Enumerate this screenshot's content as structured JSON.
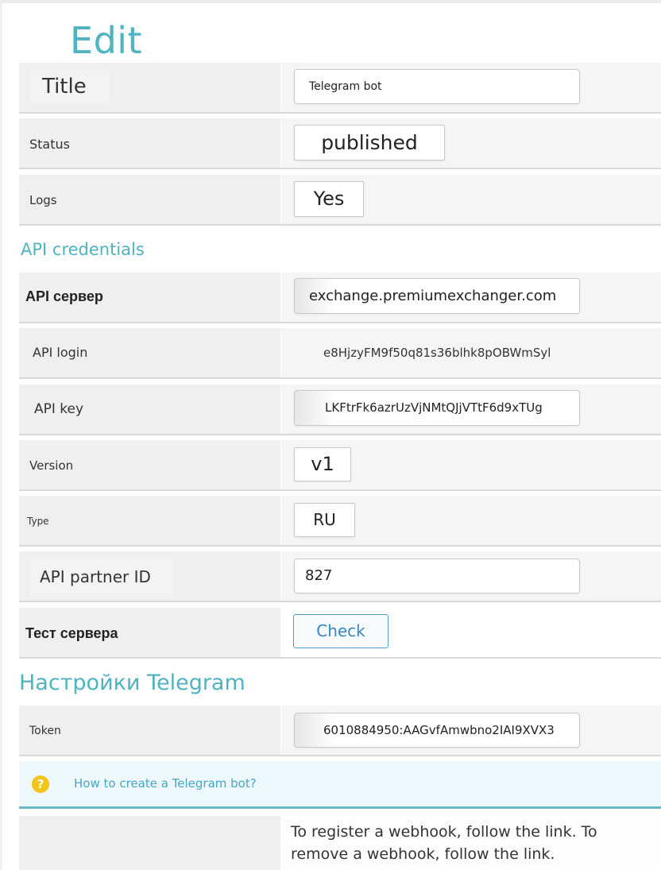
{
  "page": {
    "title": "Edit"
  },
  "general": {
    "title_label": "Title",
    "title_value": "Telegram bot",
    "status_label": "Status",
    "status_value": "published",
    "logs_label": "Logs",
    "logs_value": "Yes"
  },
  "api": {
    "section_title": "API credentials",
    "server_label": "API сервер",
    "server_value": "exchange.premiumexchanger.com",
    "login_label": "API login",
    "login_value": "e8HjzyFM9f50q81s36blhk8pOBWmSyl",
    "key_label": "API key",
    "key_value": "LKFtrFk6azrUzVjNMtQJjVTtF6d9xTUg",
    "version_label": "Version",
    "version_value": "v1",
    "type_label": "Type",
    "type_value": "RU",
    "partner_label": "API partner ID",
    "partner_value": "827",
    "test_label": "Тест сервера",
    "check_button": "Check"
  },
  "telegram": {
    "section_title": "Настройки Telegram",
    "token_label": "Token",
    "token_value": "6010884950:AAGvfAmwbno2IAI9XVX3",
    "help_icon_text": "?",
    "help_link": "How to create a Telegram bot?",
    "webhook_text": "To register a webhook, follow the link. To remove a webhook, follow the link."
  },
  "colors": {
    "accent": "#4fb3c1",
    "link": "#4aa6c6",
    "help_icon": "#f3c419",
    "button_border": "#4f9fd0"
  }
}
